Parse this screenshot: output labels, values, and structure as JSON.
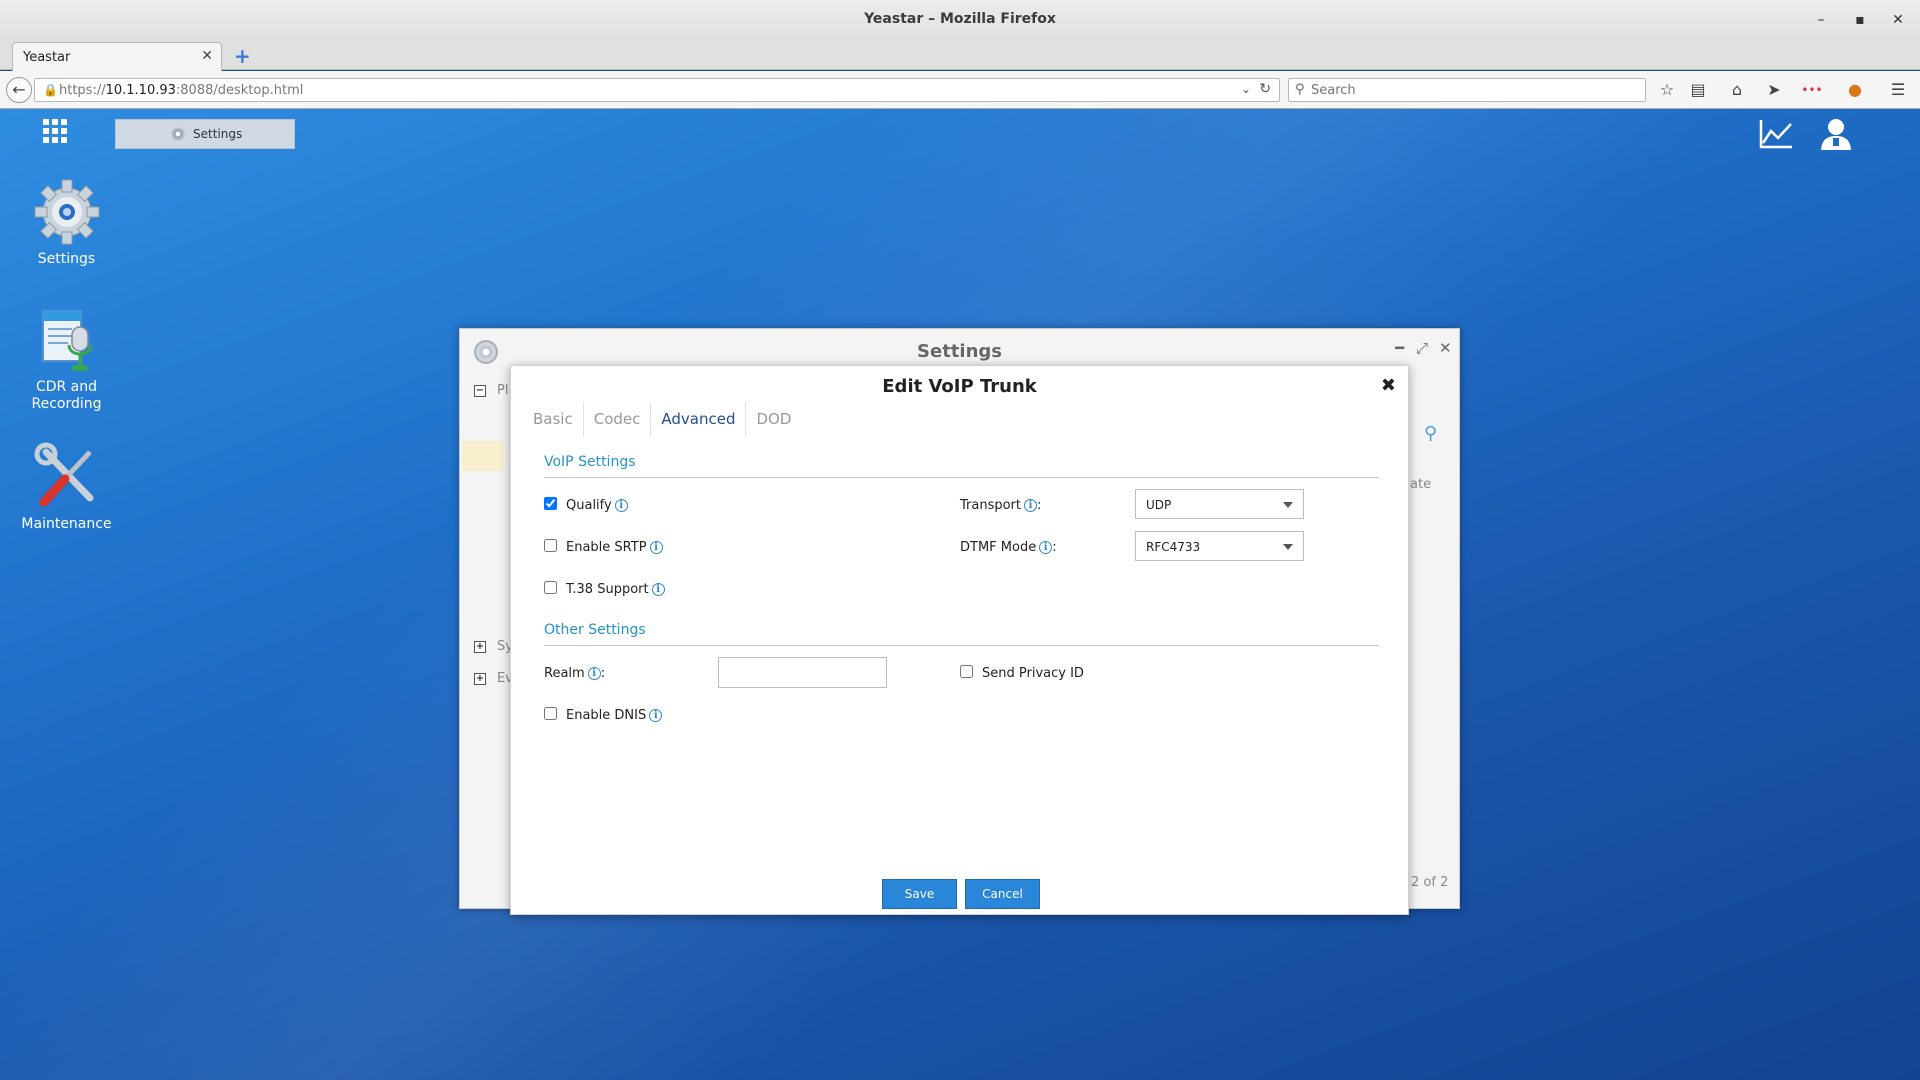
{
  "browser": {
    "window_title": "Yeastar – Mozilla Firefox",
    "tab_title": "Yeastar",
    "url_prefix": "https://",
    "url_host": "10.1.10.93",
    "url_rest": ":8088/desktop.html",
    "search_placeholder": "Search"
  },
  "desktop": {
    "taskbar_item": "Settings",
    "icons": {
      "settings": "Settings",
      "cdr_line1": "CDR and",
      "cdr_line2": "Recording",
      "maintenance": "Maintenance"
    }
  },
  "settings_window": {
    "title": "Settings",
    "bleed": {
      "p": "Pl",
      "s": "Sy",
      "e": "Ev",
      "col": "ate",
      "pager": "2 of 2"
    }
  },
  "modal": {
    "title": "Edit VoIP Trunk",
    "tabs": [
      "Basic",
      "Codec",
      "Advanced",
      "DOD"
    ],
    "active_tab": "Advanced",
    "voip_section": "VoIP Settings",
    "qualify": {
      "label": "Qualify",
      "checked": true
    },
    "enable_srtp": {
      "label": "Enable SRTP",
      "checked": false
    },
    "t38": {
      "label": "T.38 Support",
      "checked": false
    },
    "transport": {
      "label": "Transport",
      "value": "UDP"
    },
    "dtmf": {
      "label": "DTMF Mode",
      "value": "RFC4733"
    },
    "other_section": "Other Settings",
    "realm": {
      "label": "Realm",
      "value": ""
    },
    "send_privacy": {
      "label": "Send Privacy ID",
      "checked": false
    },
    "enable_dnis": {
      "label": "Enable DNIS",
      "checked": false
    },
    "save": "Save",
    "cancel": "Cancel"
  },
  "colors": {
    "accent_blue": "#2a86d8",
    "section_blue": "#2493c9",
    "desktop_blue": "#1f6fc9"
  }
}
